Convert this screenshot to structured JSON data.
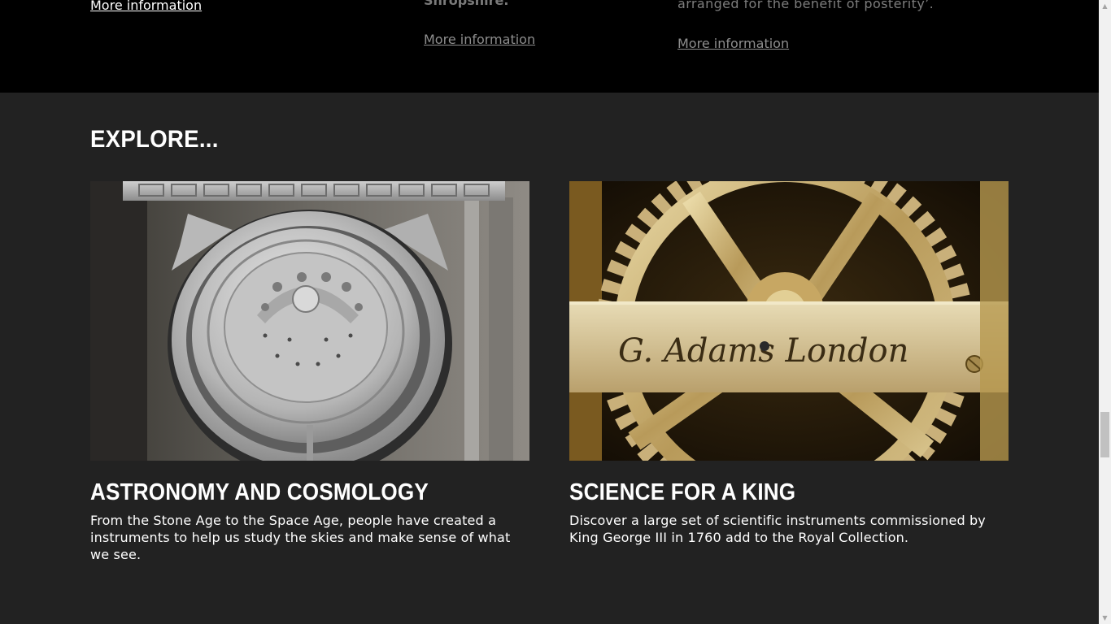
{
  "top_band": {
    "col1": {
      "link": "More information"
    },
    "col2": {
      "text": "Shropshire.",
      "link": "More information"
    },
    "col3": {
      "text": "arranged for the benefit of posterity’.",
      "link": "More information"
    }
  },
  "explore": {
    "heading": "EXPLORE...",
    "cards": [
      {
        "image": "astronomical-regulator-clock-mechanism",
        "title": "ASTRONOMY AND COSMOLOGY",
        "description": "From the Stone Age to the Space Age, people have created a instruments to help us study the skies and make sense of what we see."
      },
      {
        "image": "brass-gear-engraved-g-adams-london",
        "engraving": "G. Adams London",
        "title": "SCIENCE FOR A KING",
        "description": "Discover a large set of scientific instruments commissioned by King George III in 1760 add to the Royal Collection."
      }
    ]
  },
  "scrollbar": {
    "up_icon": "triangle-up",
    "down_icon": "triangle-down",
    "position_fraction": 0.76
  }
}
